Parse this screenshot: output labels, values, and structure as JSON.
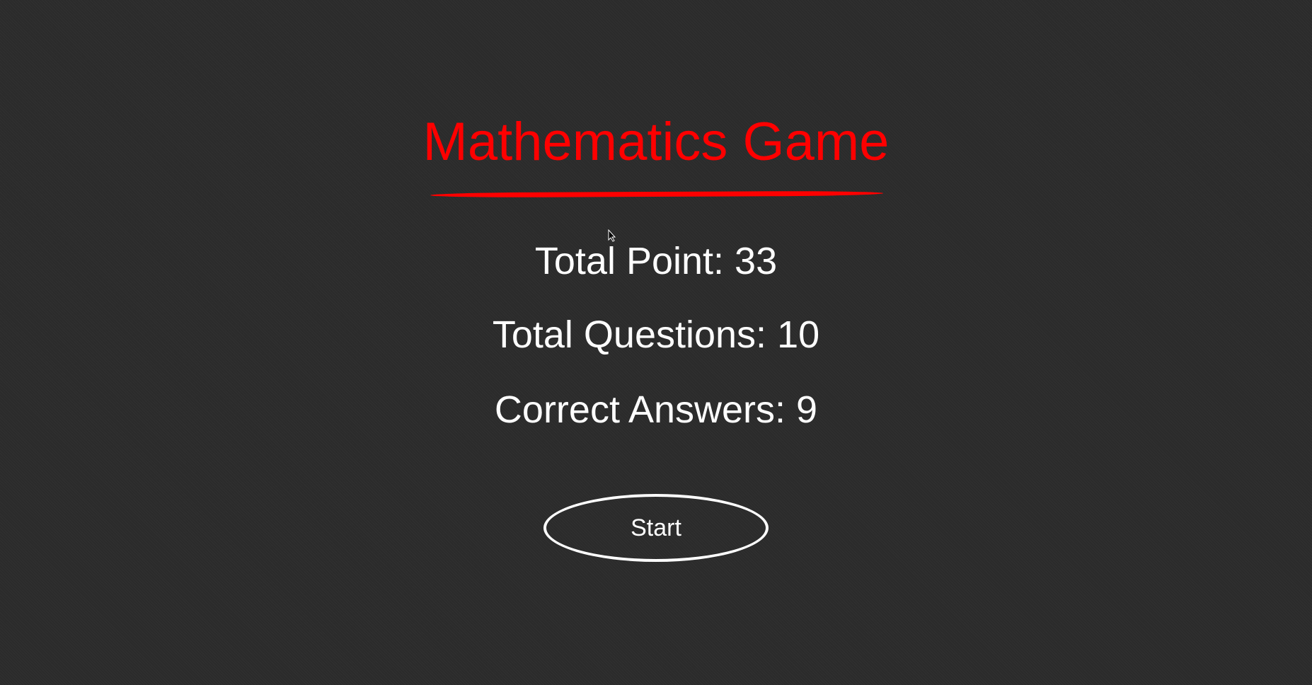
{
  "game": {
    "title": "Mathematics Game",
    "accent_color": "#ff0000",
    "stats": {
      "total_point": "Total Point: 33",
      "total_questions": "Total Questions: 10",
      "correct_answers": "Correct Answers: 9"
    },
    "start_label": "Start"
  }
}
